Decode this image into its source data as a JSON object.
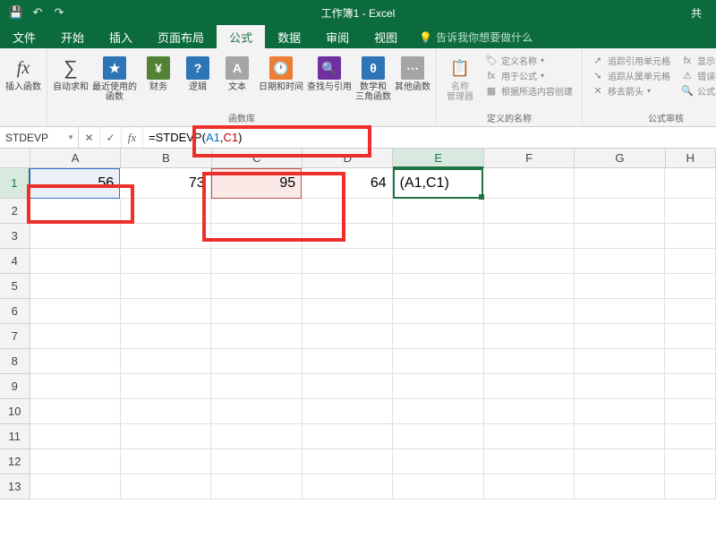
{
  "titlebar": {
    "qat_save": "💾",
    "qat_undo": "↶",
    "qat_redo": "↷",
    "title": "工作簿1 - Excel",
    "share": "共"
  },
  "tabs": {
    "file": "文件",
    "home": "开始",
    "insert": "插入",
    "layout": "页面布局",
    "formulas": "公式",
    "data": "数据",
    "review": "审阅",
    "view": "视图",
    "tellme": "告诉我你想要做什么"
  },
  "ribbon": {
    "insert_fn": "插入函数",
    "autosum": "自动求和",
    "recent": "最近使用的\n函数",
    "financial": "财务",
    "logical": "逻辑",
    "text": "文本",
    "datetime": "日期和时间",
    "lookup": "查找与引用",
    "math": "数学和\n三角函数",
    "more": "其他函数",
    "group_lib": "函数库",
    "name_mgr": "名称\n管理器",
    "define_name": "定义名称",
    "use_in_formula": "用于公式",
    "create_from_sel": "根据所选内容创建",
    "group_names": "定义的名称",
    "trace_prec": "追踪引用单元格",
    "trace_dep": "追踪从属单元格",
    "remove_arrows": "移去箭头",
    "show_formulas": "显示公式",
    "error_check": "错误检查",
    "eval": "公式求值",
    "group_audit": "公式审核"
  },
  "name_box": "STDEVP",
  "formula": {
    "raw": "=STDEVP(A1,C1)",
    "prefix": "=STDEVP(",
    "ref1": "A1",
    "comma": ",",
    "ref2": "C1",
    "suffix": ")"
  },
  "columns": [
    "A",
    "B",
    "C",
    "D",
    "E",
    "F",
    "G",
    "H"
  ],
  "rows": [
    "1",
    "2",
    "3",
    "4",
    "5",
    "6",
    "7",
    "8",
    "9",
    "10",
    "11",
    "12",
    "13"
  ],
  "cells": {
    "A1": "56",
    "B1": "73",
    "C1": "95",
    "D1": "64",
    "E1": "(A1,C1)"
  },
  "chart_data": {
    "type": "table",
    "columns": [
      "A",
      "B",
      "C",
      "D",
      "E"
    ],
    "rows": [
      {
        "A": 56,
        "B": 73,
        "C": 95,
        "D": 64,
        "E": "(A1,C1)"
      }
    ],
    "active_cell": "E1",
    "formula_bar": "=STDEVP(A1,C1)"
  }
}
